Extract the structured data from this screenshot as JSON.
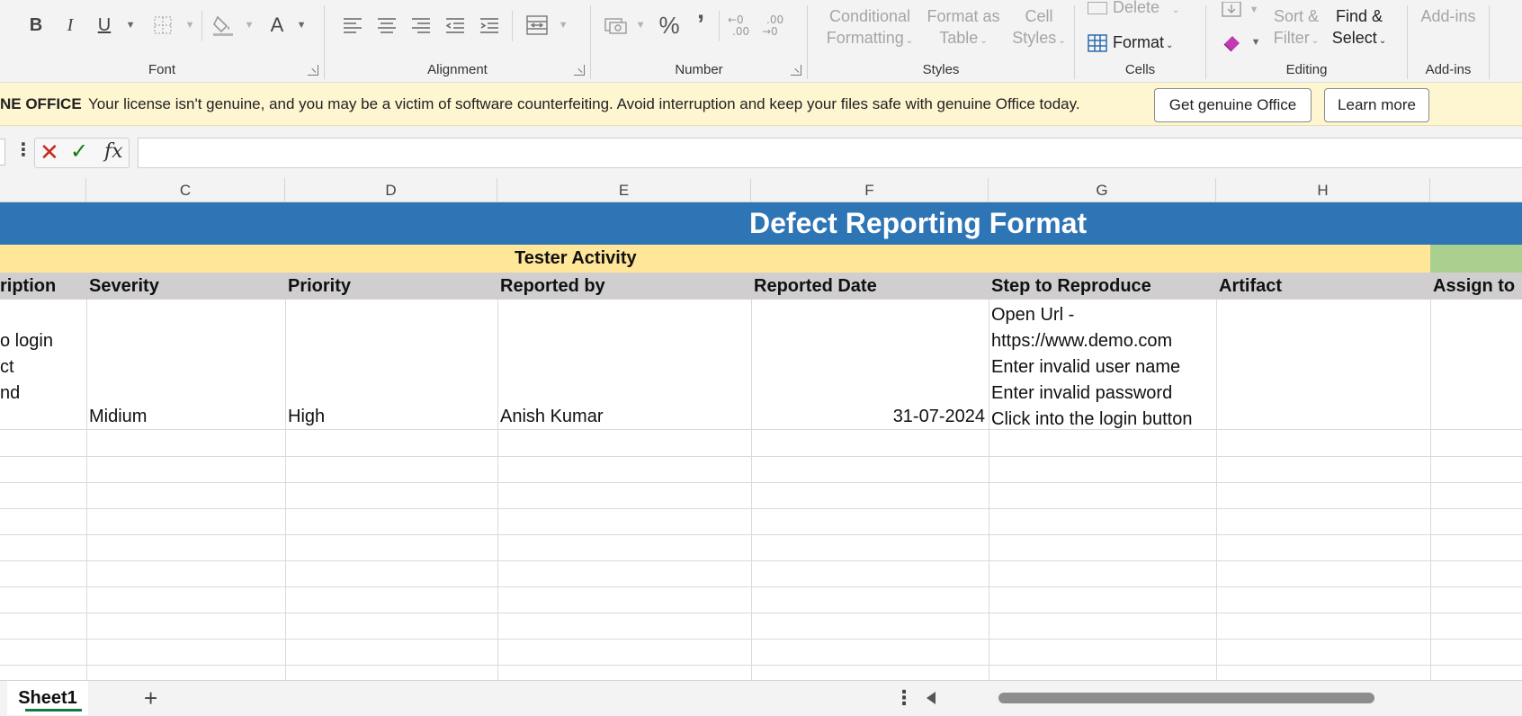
{
  "ribbon": {
    "font": {
      "label": "Font",
      "bold": "B",
      "italic": "I",
      "underline": "U",
      "font_color": "A"
    },
    "alignment": {
      "label": "Alignment"
    },
    "number": {
      "label": "Number",
      "percent": "%",
      "comma": "’"
    },
    "styles": {
      "label": "Styles",
      "conditional_formatting": [
        "Conditional",
        "Formatting"
      ],
      "format_as_table": [
        "Format as",
        "Table"
      ],
      "cell_styles": [
        "Cell",
        "Styles"
      ]
    },
    "cells": {
      "label": "Cells",
      "delete": "Delete",
      "format": "Format"
    },
    "editing": {
      "label": "Editing",
      "sort_filter": [
        "Sort &",
        "Filter"
      ],
      "find_select": [
        "Find &",
        "Select"
      ]
    },
    "addins": {
      "label": "Add-ins",
      "button": "Add-ins"
    }
  },
  "license_bar": {
    "title": "NE OFFICE",
    "message": "Your license isn't genuine, and you may be a victim of software counterfeiting. Avoid interruption and keep your files safe with genuine Office today.",
    "get_genuine_label": "Get genuine Office",
    "learn_more_label": "Learn more"
  },
  "formula_bar": {
    "fx": "fx",
    "value": ""
  },
  "columns": [
    "C",
    "D",
    "E",
    "F",
    "G",
    "H"
  ],
  "sheet": {
    "title": "Defect Reporting Format",
    "section": "Tester Activity",
    "headers": {
      "description": "ription",
      "severity": "Severity",
      "priority": "Priority",
      "reported_by": "Reported by",
      "reported_date": "Reported Date",
      "steps": "Step to Reproduce",
      "artifact": "Artifact",
      "assign_to": "Assign to"
    },
    "row1": {
      "description_lines": [
        "o login",
        "ct",
        "nd"
      ],
      "severity": "Midium",
      "priority": "High",
      "reported_by": "Anish Kumar",
      "reported_date": "31-07-2024",
      "steps_lines": [
        "Open Url -",
        "https://www.demo.com",
        "Enter invalid user name",
        "Enter invalid password",
        "Click into the login button"
      ],
      "artifact": "",
      "assign_to": ""
    }
  },
  "tabs": {
    "active": "Sheet1",
    "add": "+"
  },
  "colors": {
    "title_band": "#2e75b6",
    "section_band": "#ffe699",
    "green_band": "#a9d08e",
    "header_band": "#d0cece",
    "license_bar": "#fdf6d0"
  }
}
